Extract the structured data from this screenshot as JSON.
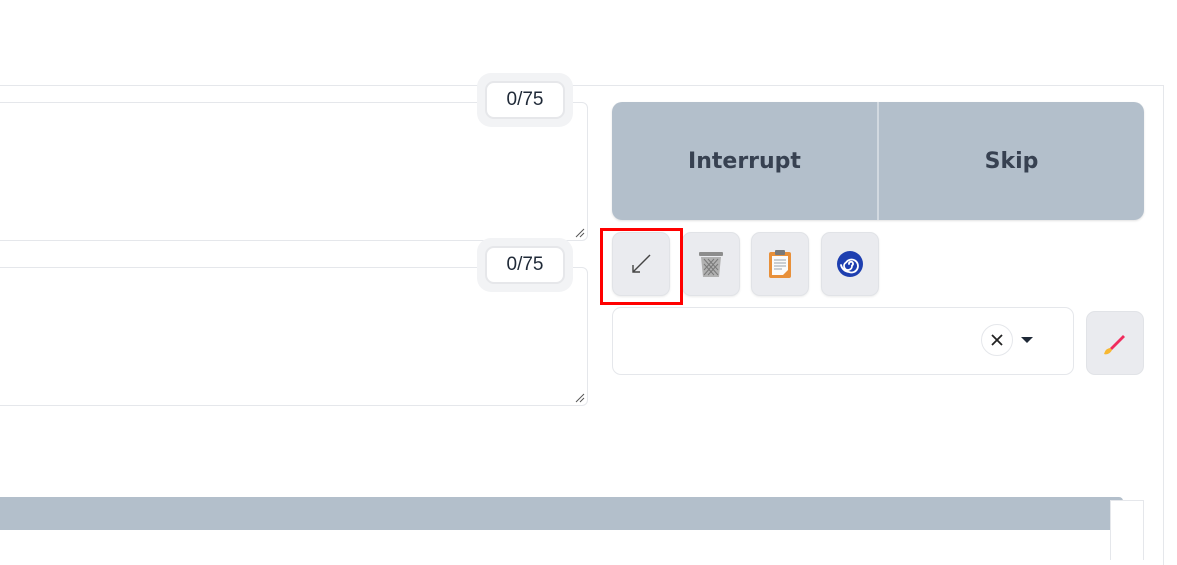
{
  "prompt": {
    "token_counter": "0/75",
    "value": ""
  },
  "negative_prompt": {
    "token_counter": "0/75",
    "value": ""
  },
  "generate_group": {
    "interrupt_label": "Interrupt",
    "skip_label": "Skip"
  },
  "tools": [
    {
      "icon": "arrow-down-left-icon"
    },
    {
      "icon": "trash-icon"
    },
    {
      "icon": "clipboard-icon"
    },
    {
      "icon": "spiral-icon"
    }
  ],
  "styles": {
    "selected_value": "",
    "edit_icon": "paintbrush-icon"
  },
  "colors": {
    "button_bg": "#b3bfcb",
    "highlight": "#ff0000",
    "spiral": "#1e3fb0",
    "clipboard": "#e8903a",
    "brush_tip": "#f02b5c",
    "brush_handle": "#f7b731"
  }
}
